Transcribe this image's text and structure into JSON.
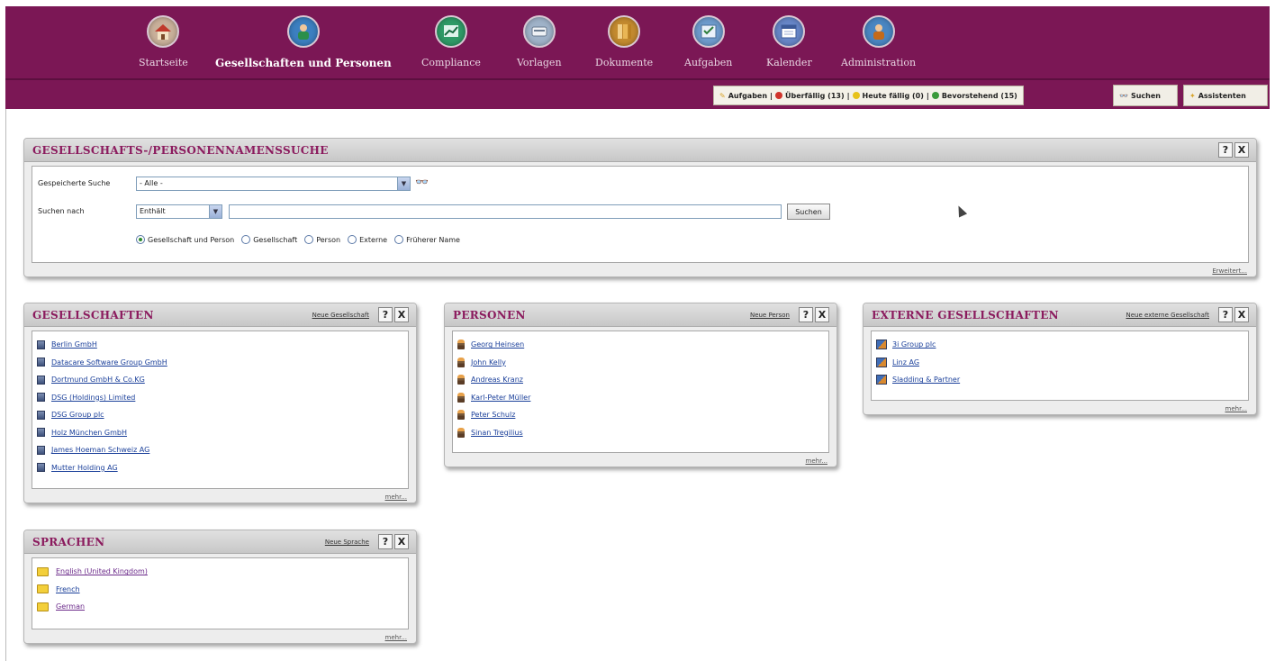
{
  "nav": {
    "items": [
      {
        "label": "Startseite",
        "color": "#c9b09a"
      },
      {
        "label": "Gesellschaften und Personen",
        "color": "#3c7fc0"
      },
      {
        "label": "Compliance",
        "color": "#2f9a67"
      },
      {
        "label": "Vorlagen",
        "color": "#9fb2c8"
      },
      {
        "label": "Dokumente",
        "color": "#c38a2f"
      },
      {
        "label": "Aufgaben",
        "color": "#6e9bcc"
      },
      {
        "label": "Kalender",
        "color": "#6786c7"
      },
      {
        "label": "Administration",
        "color": "#4a86c2"
      }
    ],
    "active_index": 1
  },
  "subbar": {
    "tasks_label": "Aufgaben",
    "overdue": "Überfällig (13)",
    "today": "Heute fällig (0)",
    "upcoming": "Bevorstehend (15)",
    "search_button": "Suchen",
    "assistant_button": "Assistenten"
  },
  "search_panel": {
    "title": "GESELLSCHAFTS-/PERSONENNAMENSSUCHE",
    "saved_search_label": "Gespeicherte Suche",
    "saved_search_value": "- Alle -",
    "search_for_label": "Suchen nach",
    "match_value": "Enthält",
    "search_button": "Suchen",
    "radios": [
      {
        "label": "Gesellschaft und Person",
        "checked": true
      },
      {
        "label": "Gesellschaft",
        "checked": false
      },
      {
        "label": "Person",
        "checked": false
      },
      {
        "label": "Externe",
        "checked": false
      },
      {
        "label": "Früherer Name",
        "checked": false
      }
    ],
    "advanced_link": "Erweitert..."
  },
  "companies_panel": {
    "title": "GESELLSCHAFTEN",
    "new_link": "Neue Gesellschaft",
    "items": [
      "Berlin GmbH",
      "Datacare Software Group GmbH",
      "Dortmund GmbH & Co.KG",
      "DSG (Holdings) Limited",
      "DSG Group plc",
      "Holz München GmbH",
      "James Hoeman Schweiz AG",
      "Mutter Holding AG"
    ],
    "more": "mehr..."
  },
  "persons_panel": {
    "title": "PERSONEN",
    "new_link": "Neue Person",
    "items": [
      "Georg Heinsen",
      "John Kelly",
      "Andreas Kranz",
      "Karl-Peter Müller",
      "Peter Schulz",
      "Sinan Tregilius"
    ],
    "more": "mehr..."
  },
  "external_panel": {
    "title": "EXTERNE GESELLSCHAFTEN",
    "new_link": "Neue externe Gesellschaft",
    "items": [
      "3i Group plc",
      "Linz AG",
      "Sladding & Partner"
    ],
    "more": "mehr..."
  },
  "languages_panel": {
    "title": "SPRACHEN",
    "new_link": "Neue Sprache",
    "items": [
      "English (United Kingdom)",
      "French",
      "German"
    ],
    "more": "mehr..."
  },
  "controls": {
    "help": "?",
    "close": "X"
  }
}
